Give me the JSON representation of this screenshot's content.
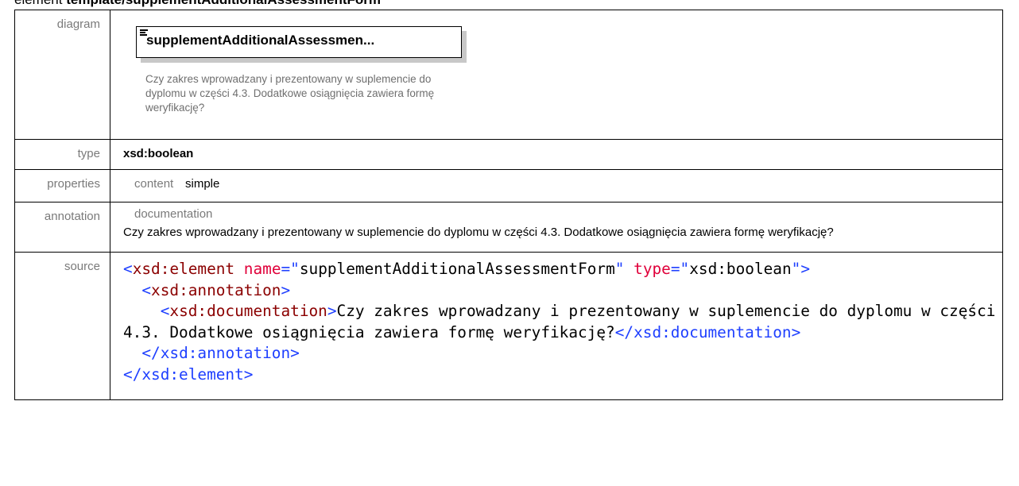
{
  "header": {
    "keyword": "element",
    "name": "template/supplementAdditionalAssessmentForm"
  },
  "rows": {
    "diagram_label": "diagram",
    "type_label": "type",
    "properties_label": "properties",
    "annotation_label": "annotation",
    "source_label": "source"
  },
  "diagram": {
    "element_name": "supplementAdditionalAssessmen...",
    "documentation": "Czy zakres wprowadzany i prezentowany w suplemencie do dyplomu w części 4.3. Dodatkowe osiągnięcia zawiera formę weryfikację?",
    "icon": "element-doc-icon"
  },
  "type": {
    "value": "xsd:boolean"
  },
  "properties": {
    "key": "content",
    "value": "simple"
  },
  "annotation": {
    "key": "documentation",
    "text": "Czy zakres wprowadzany i prezentowany w suplemencie do dyplomu w części 4.3. Dodatkowe osiągnięcia zawiera formę weryfikację?"
  },
  "source": {
    "open_tag": "xsd:element",
    "attr_name": "name",
    "attr_name_value": "supplementAdditionalAssessmentForm",
    "attr_type": "type",
    "attr_type_value": "xsd:boolean",
    "annotation_tag": "xsd:annotation",
    "documentation_tag": "xsd:documentation",
    "documentation_text": "Czy zakres wprowadzany i prezentowany w suplemencie do dyplomu w części 4.3. Dodatkowe osiągnięcia zawiera formę weryfikację?",
    "close_documentation_tag": "/xsd:documentation",
    "close_annotation_tag": "/xsd:annotation",
    "close_element_tag": "/xsd:element"
  },
  "colors": {
    "tag": "#8b0000",
    "punctuation": "#1e3fff",
    "attribute": "#e0003a",
    "label": "#7a7a7a"
  }
}
